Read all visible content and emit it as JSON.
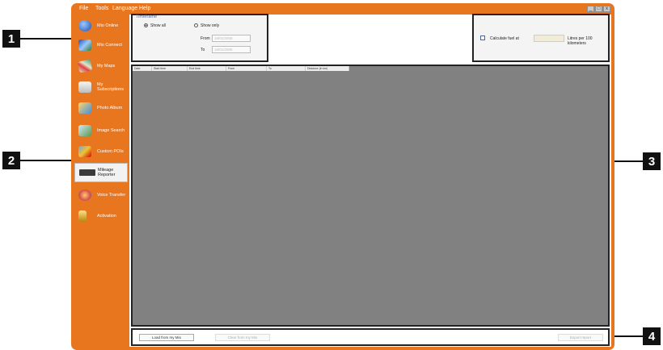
{
  "menu": [
    "File",
    "Tools",
    "Language",
    "Help"
  ],
  "window_controls": {
    "minimize": "_",
    "maximize": "□",
    "close": "x"
  },
  "sidebar": {
    "items": [
      {
        "label": "Mio Online",
        "icon": "globe-icon"
      },
      {
        "label": "Mio Connect",
        "icon": "connect-icon"
      },
      {
        "label": "My Maps",
        "icon": "map-icon"
      },
      {
        "label": "My Subscriptions",
        "icon": "subscription-icon"
      },
      {
        "label": "Photo Album",
        "icon": "photo-album-icon"
      },
      {
        "label": "Image Search",
        "icon": "image-search-icon"
      },
      {
        "label": "Custom POIs",
        "icon": "poi-icon"
      },
      {
        "label": "Mileage Reporter",
        "icon": "mileage-icon"
      },
      {
        "label": "Voice Transfer",
        "icon": "voice-icon"
      },
      {
        "label": "Activation",
        "icon": "activation-icon"
      }
    ]
  },
  "timeframe": {
    "legend": "Timeframe",
    "show_all": "Show all",
    "show_only": "Show only",
    "from_label": "From",
    "from_value": "16/01/2008",
    "to_label": "To",
    "to_value": "16/01/2008"
  },
  "fuel": {
    "calc_label": "Calculate fuel at",
    "units": "Litres per 100 kilometers"
  },
  "grid": {
    "columns": [
      "Date",
      "Start time",
      "End time",
      "From",
      "To",
      "Distance (in km)"
    ]
  },
  "buttons": {
    "load": "Load from my Mio",
    "clear": "Clear from my Mio",
    "export": "Export report"
  },
  "callouts": [
    "1",
    "2",
    "3",
    "4"
  ]
}
